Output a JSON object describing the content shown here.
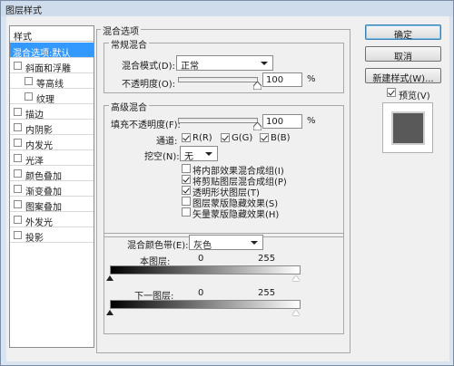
{
  "window": {
    "title": "图层样式"
  },
  "styles_panel": {
    "header": "样式",
    "items": [
      {
        "label": "混合选项:默认",
        "checkbox": false,
        "indent": 0,
        "active": true
      },
      {
        "label": "斜面和浮雕",
        "checkbox": true,
        "indent": 0,
        "active": false
      },
      {
        "label": "等高线",
        "checkbox": true,
        "indent": 1,
        "active": false
      },
      {
        "label": "纹理",
        "checkbox": true,
        "indent": 1,
        "active": false
      },
      {
        "label": "描边",
        "checkbox": true,
        "indent": 0,
        "active": false
      },
      {
        "label": "内阴影",
        "checkbox": true,
        "indent": 0,
        "active": false
      },
      {
        "label": "内发光",
        "checkbox": true,
        "indent": 0,
        "active": false
      },
      {
        "label": "光泽",
        "checkbox": true,
        "indent": 0,
        "active": false
      },
      {
        "label": "颜色叠加",
        "checkbox": true,
        "indent": 0,
        "active": false
      },
      {
        "label": "渐变叠加",
        "checkbox": true,
        "indent": 0,
        "active": false
      },
      {
        "label": "图案叠加",
        "checkbox": true,
        "indent": 0,
        "active": false
      },
      {
        "label": "外发光",
        "checkbox": true,
        "indent": 0,
        "active": false
      },
      {
        "label": "投影",
        "checkbox": true,
        "indent": 0,
        "active": false
      }
    ]
  },
  "blending": {
    "section_title": "混合选项",
    "general": {
      "title": "常规混合",
      "mode_label": "混合模式(D):",
      "mode_value": "正常",
      "opacity_label": "不透明度(O):",
      "opacity_value": "100",
      "opacity_unit": "%",
      "opacity_level": 1.0
    },
    "advanced": {
      "title": "高级混合",
      "fill_label": "填充不透明度(F):",
      "fill_value": "100",
      "fill_unit": "%",
      "fill_level": 1.0,
      "channels_label": "通道:",
      "channel_r": "R(R)",
      "channel_g": "G(G)",
      "channel_b": "B(B)",
      "knockout_label": "挖空(N):",
      "knockout_value": "无",
      "options": [
        {
          "label": "将内部效果混合成组(I)",
          "checked": false
        },
        {
          "label": "将剪贴图层混合成组(P)",
          "checked": true
        },
        {
          "label": "透明形状图层(T)",
          "checked": true
        },
        {
          "label": "图层蒙版隐藏效果(S)",
          "checked": false
        },
        {
          "label": "矢量蒙版隐藏效果(H)",
          "checked": false
        }
      ]
    },
    "blend_if": {
      "label": "混合颜色带(E):",
      "value": "灰色",
      "this_layer_label": "本图层:",
      "this_layer_min": "0",
      "this_layer_max": "255",
      "underlying_label": "下一图层:",
      "underlying_min": "0",
      "underlying_max": "255"
    }
  },
  "buttons": {
    "ok": "确定",
    "cancel": "取消",
    "new_style": "新建样式(W)...",
    "preview_label": "预览(V)"
  },
  "colors": {
    "highlight": "#3399ff",
    "preview_swatch": "#595959"
  }
}
